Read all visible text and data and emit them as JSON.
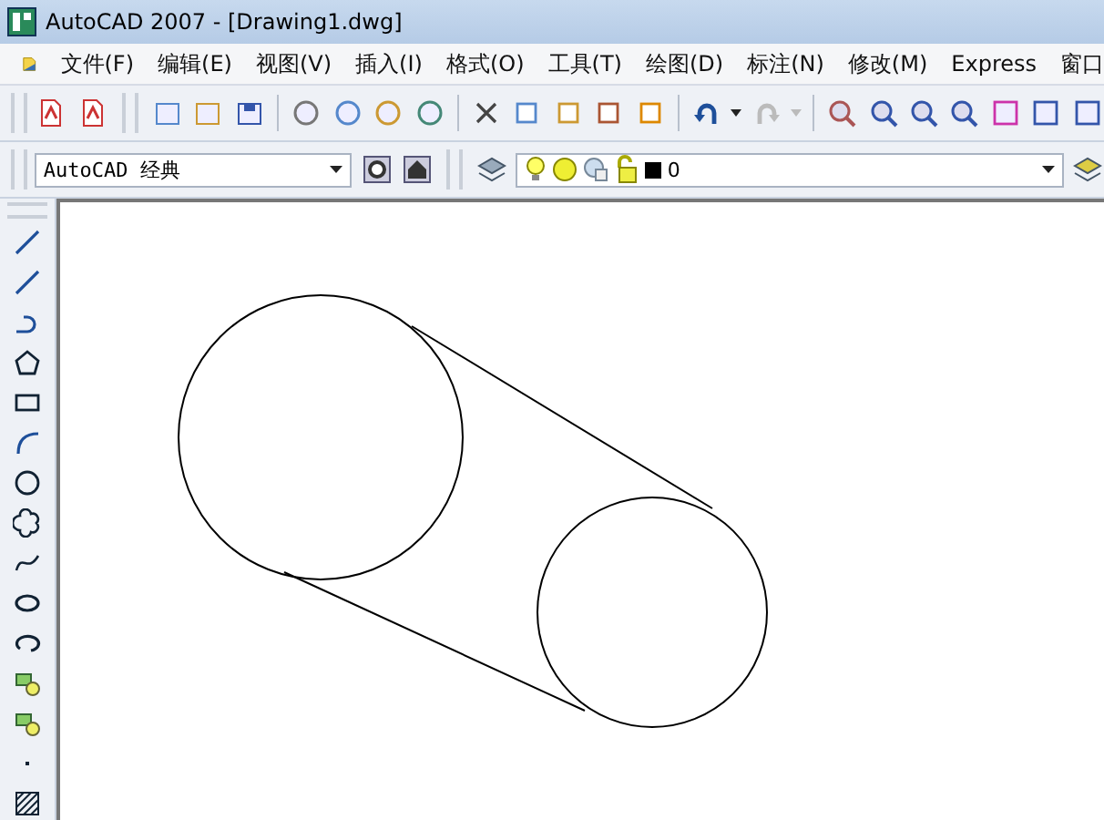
{
  "window": {
    "title": "AutoCAD 2007 - [Drawing1.dwg]"
  },
  "menu": [
    "文件(F)",
    "编辑(E)",
    "视图(V)",
    "插入(I)",
    "格式(O)",
    "工具(T)",
    "绘图(D)",
    "标注(N)",
    "修改(M)",
    "Express",
    "窗口"
  ],
  "toolbar": {
    "redo": {
      "disabled": true
    }
  },
  "workspace": {
    "value": "AutoCAD 经典"
  },
  "layer": {
    "value": "0"
  }
}
